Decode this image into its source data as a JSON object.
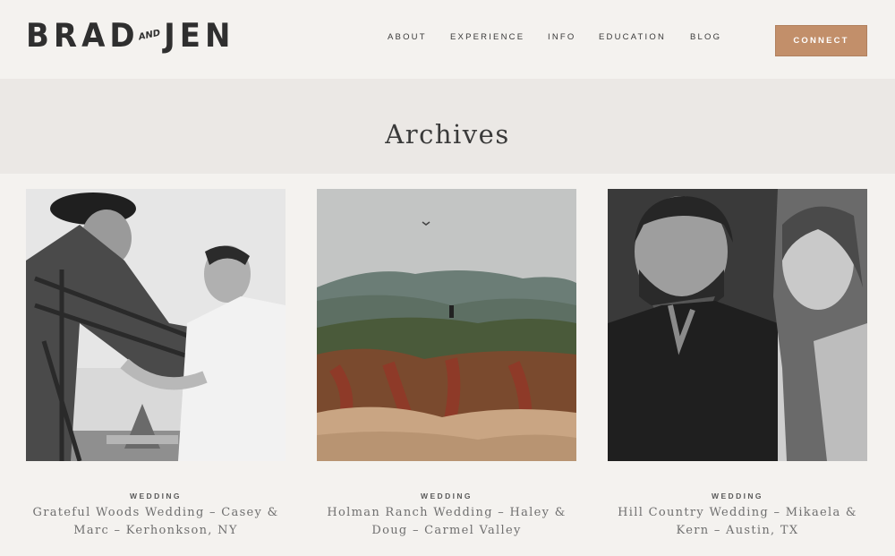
{
  "header": {
    "logo": {
      "left_word": "BRAD",
      "and_word": "AND",
      "right_word": "JEN"
    },
    "nav": [
      {
        "label": "ABOUT"
      },
      {
        "label": "EXPERIENCE"
      },
      {
        "label": "INFO"
      },
      {
        "label": "EDUCATION"
      },
      {
        "label": "BLOG"
      }
    ],
    "connect_label": "CONNECT"
  },
  "page": {
    "title": "Archives"
  },
  "posts": [
    {
      "category": "WEDDING",
      "title": "Grateful Woods Wedding – Casey & Marc – Kerhonkson, NY",
      "image": "black-and-white couple laughing photo"
    },
    {
      "category": "WEDDING",
      "title": "Holman Ranch Wedding – Haley & Doug – Carmel Valley",
      "image": "couple on coastal cliff photo"
    },
    {
      "category": "WEDDING",
      "title": "Hill Country Wedding – Mikaela & Kern – Austin, TX",
      "image": "black-and-white couple smiling photo"
    }
  ],
  "colors": {
    "accent": "#c28f6a",
    "background": "#f4f2ef",
    "band": "#ebe8e5"
  }
}
